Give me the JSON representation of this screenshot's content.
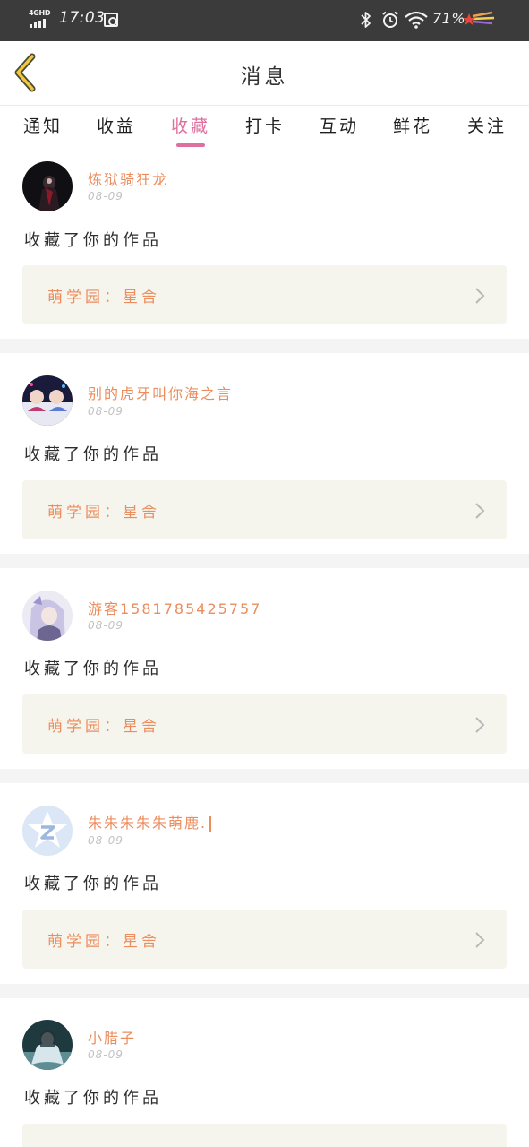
{
  "status_bar": {
    "network": "4GHD",
    "time": "17:03",
    "battery": "71%",
    "icons": [
      "signal-icon",
      "nfc-icon",
      "bluetooth-icon",
      "alarm-icon",
      "wifi-icon",
      "shooting-star-icon"
    ]
  },
  "header": {
    "back_icon": "chevron-left-icon",
    "title": "消息"
  },
  "tabs": [
    {
      "label": "通知"
    },
    {
      "label": "收益"
    },
    {
      "label": "收藏",
      "active": true
    },
    {
      "label": "打卡"
    },
    {
      "label": "互动"
    },
    {
      "label": "鲜花"
    },
    {
      "label": "关注"
    }
  ],
  "colors": {
    "accent_pink": "#df6f9e",
    "username_orange": "#ec8d5d",
    "target_bg": "#f5f5ee",
    "status_bar_bg": "#3b3b3b"
  },
  "messages": [
    {
      "username": "炼狱骑狂龙",
      "date": "08-09",
      "action": "收藏了你的作品",
      "target": "萌学园：星舍"
    },
    {
      "username": "别的虎牙叫你海之言",
      "date": "08-09",
      "action": "收藏了你的作品",
      "target": "萌学园：星舍"
    },
    {
      "username": "游客1581785425757",
      "date": "08-09",
      "action": "收藏了你的作品",
      "target": "萌学园：星舍"
    },
    {
      "username": "朱朱朱朱朱萌鹿.",
      "date": "08-09",
      "action": "收藏了你的作品",
      "target": "萌学园：星舍"
    },
    {
      "username": "小腊子",
      "date": "08-09",
      "action": "收藏了你的作品",
      "target": ""
    }
  ]
}
